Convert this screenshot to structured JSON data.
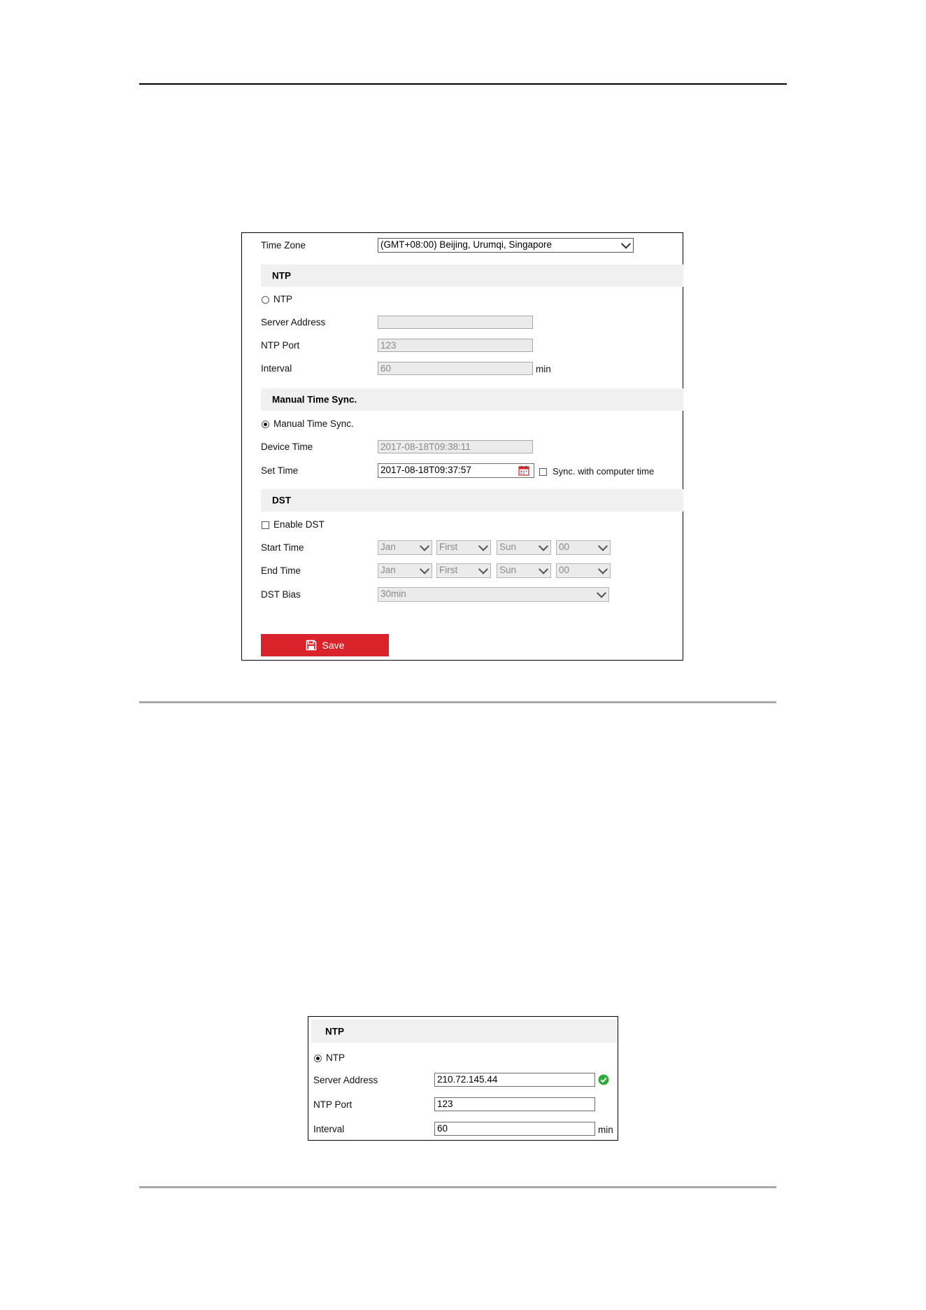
{
  "time_settings": {
    "time_zone": {
      "label": "Time Zone",
      "value": "(GMT+08:00) Beijing, Urumqi, Singapore"
    },
    "ntp": {
      "section_title": "NTP",
      "radio_label": "NTP",
      "selected": false,
      "server_address": {
        "label": "Server Address",
        "value": ""
      },
      "ntp_port": {
        "label": "NTP Port",
        "value": "123"
      },
      "interval": {
        "label": "Interval",
        "value": "60",
        "unit": "min"
      }
    },
    "manual": {
      "section_title": "Manual Time Sync.",
      "radio_label": "Manual Time Sync.",
      "selected": true,
      "device_time": {
        "label": "Device Time",
        "value": "2017-08-18T09:38:11"
      },
      "set_time": {
        "label": "Set Time",
        "value": "2017-08-18T09:37:57"
      },
      "sync_label": "Sync. with computer time"
    },
    "dst": {
      "section_title": "DST",
      "enable_label": "Enable DST",
      "start_time": {
        "label": "Start Time",
        "month": "Jan",
        "week": "First",
        "day": "Sun",
        "hour": "00"
      },
      "end_time": {
        "label": "End Time",
        "month": "Jan",
        "week": "First",
        "day": "Sun",
        "hour": "00"
      },
      "bias": {
        "label": "DST Bias",
        "value": "30min"
      }
    },
    "save_label": "Save"
  },
  "ntp_panel": {
    "section_title": "NTP",
    "radio_label": "NTP",
    "selected": true,
    "server_address": {
      "label": "Server Address",
      "value": "210.72.145.44"
    },
    "ntp_port": {
      "label": "NTP Port",
      "value": "123"
    },
    "interval": {
      "label": "Interval",
      "value": "60",
      "unit": "min"
    }
  },
  "colors": {
    "save_button": "#d9222a",
    "section_bg": "#f0f0f0",
    "valid_icon": "#2eaa3e",
    "calendar_icon": "#d9222a"
  }
}
